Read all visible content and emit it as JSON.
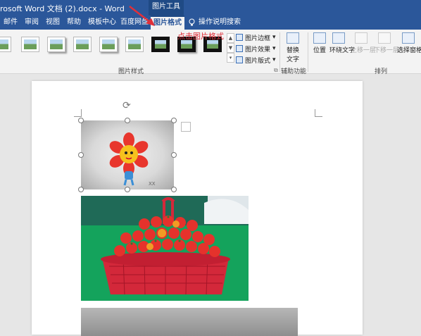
{
  "window": {
    "title": "rosoft Word 文档 (2).docx  -  Word",
    "context_tab_group": "图片工具"
  },
  "tabs": [
    {
      "label": "邮件"
    },
    {
      "label": "审阅"
    },
    {
      "label": "视图"
    },
    {
      "label": "帮助"
    },
    {
      "label": "模板中心"
    },
    {
      "label": "百度网盘"
    },
    {
      "label": "图片格式",
      "active": true
    }
  ],
  "search": {
    "label": "操作说明搜索",
    "icon": "lightbulb-icon"
  },
  "ribbon": {
    "picture_styles_group": "图片样式",
    "style_menu": [
      {
        "label": "图片边框",
        "icon": "picture-border-icon"
      },
      {
        "label": "图片效果",
        "icon": "picture-effects-icon"
      },
      {
        "label": "图片版式",
        "icon": "picture-layout-icon"
      }
    ],
    "accessibility_group": "辅助功能",
    "alt_text": {
      "line1": "替换",
      "line2": "文字"
    },
    "arrange_group": "排列",
    "arrange": [
      {
        "label": "位置",
        "enabled": true
      },
      {
        "label": "环绕文字",
        "enabled": true
      },
      {
        "label": "上移一层",
        "enabled": false
      },
      {
        "label": "下移一层",
        "enabled": false
      },
      {
        "label": "选择窗格",
        "enabled": true
      }
    ]
  },
  "annotation": {
    "text": "点击图片格式",
    "color": "#e0303a"
  },
  "colors": {
    "brand": "#2b579a",
    "ribbon_bg": "#f3f3f3"
  }
}
